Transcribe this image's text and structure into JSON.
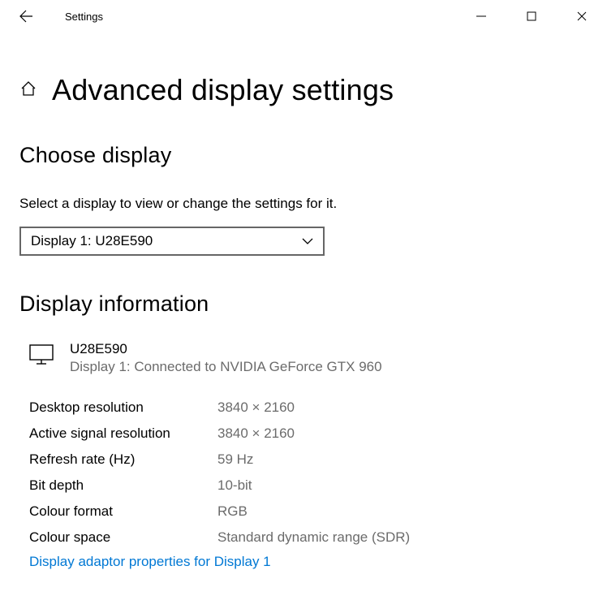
{
  "window": {
    "title": "Settings"
  },
  "page": {
    "heading": "Advanced display settings",
    "choose_display_heading": "Choose display",
    "choose_display_subtext": "Select a display to view or change the settings for it.",
    "dropdown_selected": "Display 1: U28E590",
    "display_info_heading": "Display information",
    "display_name": "U28E590",
    "display_connection": "Display 1: Connected to NVIDIA GeForce GTX 960",
    "info": {
      "desktop_resolution": {
        "label": "Desktop resolution",
        "value": "3840 × 2160"
      },
      "active_signal_resolution": {
        "label": "Active signal resolution",
        "value": "3840 × 2160"
      },
      "refresh_rate": {
        "label": "Refresh rate (Hz)",
        "value": "59 Hz"
      },
      "bit_depth": {
        "label": "Bit depth",
        "value": "10-bit"
      },
      "colour_format": {
        "label": "Colour format",
        "value": "RGB"
      },
      "colour_space": {
        "label": "Colour space",
        "value": "Standard dynamic range (SDR)"
      }
    },
    "adaptor_link": "Display adaptor properties for Display 1"
  }
}
